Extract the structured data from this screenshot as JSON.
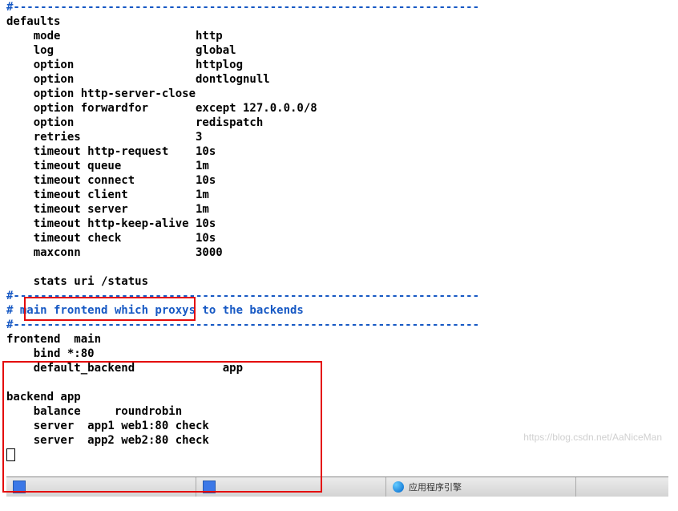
{
  "top_dash": "#---------------------------------------------------------------------",
  "defaults": {
    "heading": "defaults",
    "lines": [
      "    mode                    http",
      "    log                     global",
      "    option                  httplog",
      "    option                  dontlognull",
      "    option http-server-close",
      "    option forwardfor       except 127.0.0.0/8",
      "    option                  redispatch",
      "    retries                 3",
      "    timeout http-request    10s",
      "    timeout queue           1m",
      "    timeout connect         10s",
      "    timeout client          1m",
      "    timeout server          1m",
      "    timeout http-keep-alive 10s",
      "    timeout check           10s",
      "    maxconn                 3000"
    ],
    "stats_line": "    stats uri /status"
  },
  "sep1": "#---------------------------------------------------------------------",
  "comment_main": "# main frontend which proxys to the backends",
  "sep2": "#---------------------------------------------------------------------",
  "frontend": {
    "heading": "frontend  main",
    "bind": "    bind *:80",
    "default": "    default_backend             app"
  },
  "backend": {
    "heading": "backend app",
    "balance": "    balance     roundrobin",
    "server1": "    server  app1 web1:80 check",
    "server2": "    server  app2 web2:80 check"
  },
  "watermark": "https://blog.csdn.net/AaNiceMan",
  "taskbar": {
    "item1": " ",
    "item2": " ",
    "item3": "应用程序引擎"
  }
}
